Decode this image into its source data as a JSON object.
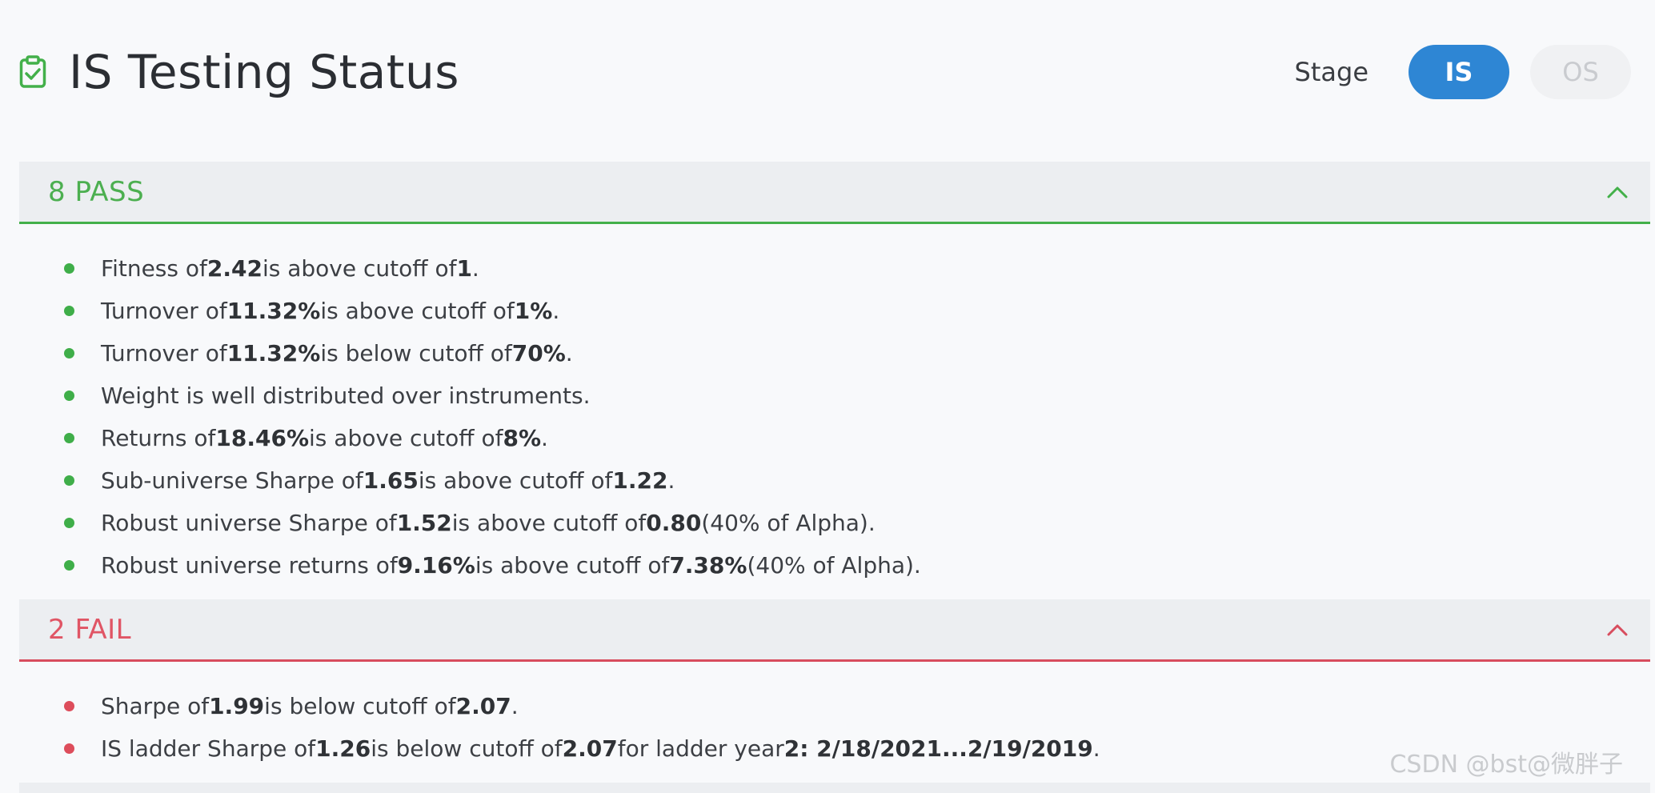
{
  "header": {
    "title": "IS Testing Status",
    "stage_label": "Stage",
    "stage_options": [
      "IS",
      "OS"
    ],
    "active_stage": "IS"
  },
  "sections": {
    "pass": {
      "label": "8 PASS",
      "items": [
        [
          {
            "t": "Fitness of "
          },
          {
            "t": "2.42",
            "b": true
          },
          {
            "t": " is above cutoff of "
          },
          {
            "t": "1",
            "b": true
          },
          {
            "t": "."
          }
        ],
        [
          {
            "t": "Turnover of "
          },
          {
            "t": "11.32%",
            "b": true
          },
          {
            "t": " is above cutoff of "
          },
          {
            "t": "1%",
            "b": true
          },
          {
            "t": "."
          }
        ],
        [
          {
            "t": "Turnover of "
          },
          {
            "t": "11.32%",
            "b": true
          },
          {
            "t": " is below cutoff of "
          },
          {
            "t": "70%",
            "b": true
          },
          {
            "t": "."
          }
        ],
        [
          {
            "t": "Weight is well distributed over instruments."
          }
        ],
        [
          {
            "t": "Returns of "
          },
          {
            "t": "18.46%",
            "b": true
          },
          {
            "t": " is above cutoff of "
          },
          {
            "t": "8%",
            "b": true
          },
          {
            "t": "."
          }
        ],
        [
          {
            "t": "Sub-universe Sharpe of "
          },
          {
            "t": "1.65",
            "b": true
          },
          {
            "t": " is above cutoff of "
          },
          {
            "t": "1.22",
            "b": true
          },
          {
            "t": "."
          }
        ],
        [
          {
            "t": "Robust universe Sharpe of "
          },
          {
            "t": "1.52",
            "b": true
          },
          {
            "t": " is above cutoff of "
          },
          {
            "t": "0.80",
            "b": true
          },
          {
            "t": " (40% of Alpha)."
          }
        ],
        [
          {
            "t": "Robust universe returns of "
          },
          {
            "t": "9.16%",
            "b": true
          },
          {
            "t": " is above cutoff of "
          },
          {
            "t": "7.38%",
            "b": true
          },
          {
            "t": " (40% of Alpha)."
          }
        ]
      ]
    },
    "fail": {
      "label": "2 FAIL",
      "items": [
        [
          {
            "t": "Sharpe of "
          },
          {
            "t": "1.99",
            "b": true
          },
          {
            "t": " is below cutoff of "
          },
          {
            "t": "2.07",
            "b": true
          },
          {
            "t": "."
          }
        ],
        [
          {
            "t": "IS ladder Sharpe of "
          },
          {
            "t": "1.26",
            "b": true
          },
          {
            "t": " is below cutoff of "
          },
          {
            "t": "2.07",
            "b": true
          },
          {
            "t": " for ladder year "
          },
          {
            "t": "2: 2/18/2021...2/19/2019",
            "b": true
          },
          {
            "t": "."
          }
        ]
      ]
    }
  },
  "watermark": "CSDN @bst@微胖子",
  "colors": {
    "pass": "#43b04a",
    "fail": "#d84d5e",
    "accent": "#2e86d4"
  },
  "icons": {
    "title": "clipboard-check-icon",
    "collapse": "chevron-up-icon"
  }
}
